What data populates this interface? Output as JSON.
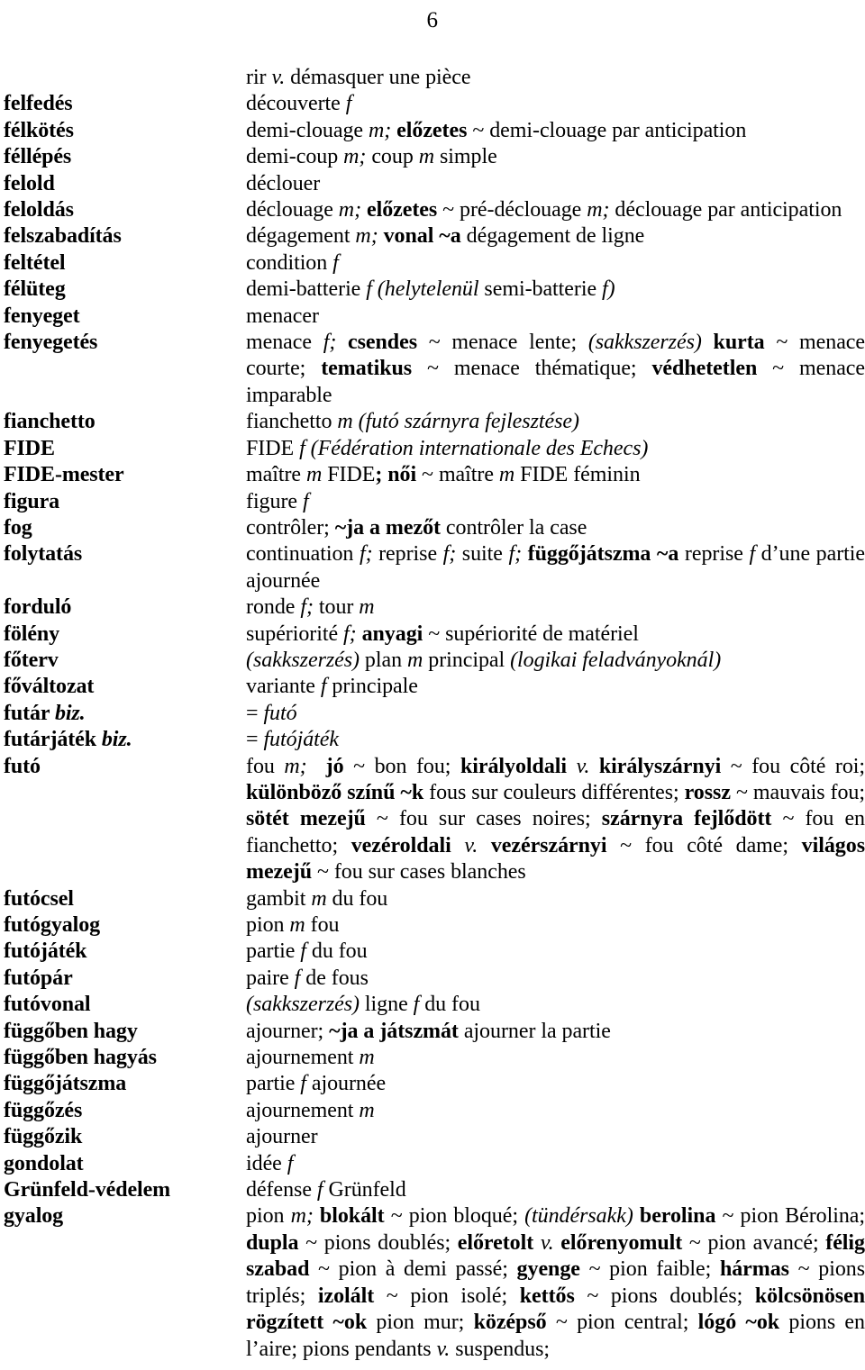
{
  "page": {
    "number": "6",
    "type": "dictionary-page",
    "source_language": "Hungarian",
    "target_language": "French",
    "subject": "chess"
  },
  "continuation_line": {
    "text_html": "rir <i>v.</i> démasquer une pièce"
  },
  "entries": [
    {
      "headword_html": "felfedés",
      "definition_html": "découverte <i>f</i>",
      "justify": false
    },
    {
      "headword_html": "félkötés",
      "definition_html": "demi-clouage <i>m;</i> <b>előzetes</b> ~ demi-clouage par anticipation",
      "justify": false
    },
    {
      "headword_html": "féllépés",
      "definition_html": "demi-coup <i>m;</i> coup <i>m</i> simple",
      "justify": false
    },
    {
      "headword_html": "felold",
      "definition_html": "déclouer",
      "justify": false
    },
    {
      "headword_html": "feloldás",
      "definition_html": "déclouage <i>m;</i> <b>előzetes</b> ~ pré-déclouage <i>m;</i> déclouage par anti&shy;cipation",
      "justify": true
    },
    {
      "headword_html": "felszabadítás",
      "definition_html": "dégagement <i>m;</i> <b>vonal ~a</b> dégagement de ligne",
      "justify": false
    },
    {
      "headword_html": "feltétel",
      "definition_html": "condition <i>f</i>",
      "justify": false
    },
    {
      "headword_html": "félüteg",
      "definition_html": "demi-batterie <i>f (helytelenül</i> semi-batterie <i>f)</i>",
      "justify": false
    },
    {
      "headword_html": "fenyeget",
      "definition_html": "menacer",
      "justify": false
    },
    {
      "headword_html": "fenyegetés",
      "definition_html": "menace <i>f;</i> <b>csendes</b> ~ menace lente; <i>(sakkszerzés)</i> <b>kurta</b> ~ menace courte; <b>tematikus</b> ~ menace thématique; <b>védhetetlen</b> ~ menace imparable",
      "justify": true
    },
    {
      "headword_html": "fianchetto",
      "definition_html": "fianchetto <i>m (futó szárnyra fejlesztése)</i>",
      "justify": false
    },
    {
      "headword_html": "FIDE",
      "definition_html": "FIDE <i>f (Fédération internationale des Echecs)</i>",
      "justify": false
    },
    {
      "headword_html": "FIDE-mester",
      "definition_html": "maître <i>m</i> FIDE<b>; női</b> ~ maître <i>m</i> FIDE féminin",
      "justify": false
    },
    {
      "headword_html": "figura",
      "definition_html": "figure <i>f</i>",
      "justify": false
    },
    {
      "headword_html": "fog",
      "definition_html": "contrôler; <b>~ja a mezőt</b> contrôler la case",
      "justify": false
    },
    {
      "headword_html": "folytatás",
      "definition_html": "continuation <i>f;</i> reprise <i>f;</i> suite <i>f;</i> <b>függőjátszma ~a</b> reprise <i>f</i> d&rsquo;une partie ajournée",
      "justify": true
    },
    {
      "headword_html": "forduló",
      "definition_html": "ronde <i>f;</i> tour <i>m</i>",
      "justify": false
    },
    {
      "headword_html": "fölény",
      "definition_html": "supériorité <i>f;</i> <b>anyagi</b> ~ supériorité de matériel",
      "justify": false
    },
    {
      "headword_html": "főterv",
      "definition_html": "<i>(sakkszerzés)</i> plan <i>m</i> principal <i>(logikai feladványoknál)</i>",
      "justify": false
    },
    {
      "headword_html": "főváltozat",
      "definition_html": "variante <i>f</i> principale",
      "justify": false
    },
    {
      "headword_html": "futár <span class=\"abbr\">biz.</span>",
      "definition_html": "= <i>futó</i>",
      "justify": false
    },
    {
      "headword_html": "futárjáték <span class=\"abbr\">biz.</span>",
      "definition_html": "= <i>futójáték</i>",
      "justify": false
    },
    {
      "headword_html": "futó",
      "definition_html": "fou <i>m;</i>&nbsp; <b>jó</b> ~ bon fou; <b>királyoldali</b> <i>v.</i> <b>királyszárnyi</b> ~ fou côté roi; <b>különböző színű ~k</b> fous sur couleurs différentes; <b>rossz</b> ~ mauvais fou; <b>sötét mezejű</b> ~ fou sur cases noires; <b>szárnyra fejlődött</b> ~ fou en fianchetto; <b>vezéroldali</b> <i>v.</i> <b>vezérszárnyi</b> ~ fou côté dame; <b>világos mezejű</b> ~ fou sur cases blanches",
      "justify": true
    },
    {
      "headword_html": "futócsel",
      "definition_html": "gambit <i>m</i> du fou",
      "justify": false
    },
    {
      "headword_html": "futógyalog",
      "definition_html": "pion <i>m</i> fou",
      "justify": false
    },
    {
      "headword_html": "futójáték",
      "definition_html": "partie <i>f</i> du fou",
      "justify": false
    },
    {
      "headword_html": "futópár",
      "definition_html": "paire <i>f</i> de fous",
      "justify": false
    },
    {
      "headword_html": "futóvonal",
      "definition_html": "<i>(sakkszerzés)</i> ligne <i>f</i> du fou",
      "justify": false
    },
    {
      "headword_html": "függőben hagy",
      "definition_html": "ajourner; <b>~ja a játszmát</b> ajourner la partie",
      "justify": false
    },
    {
      "headword_html": "függőben hagyás",
      "definition_html": "ajournement <i>m</i>",
      "justify": false
    },
    {
      "headword_html": "függőjátszma",
      "definition_html": "partie <i>f</i> ajournée",
      "justify": false
    },
    {
      "headword_html": "függőzés",
      "definition_html": "ajournement <i>m</i>",
      "justify": false
    },
    {
      "headword_html": "függőzik",
      "definition_html": "ajourner",
      "justify": false
    },
    {
      "headword_html": "gondolat",
      "definition_html": "idée <i>f</i>",
      "justify": false
    },
    {
      "headword_html": "Grünfeld-védelem",
      "definition_html": "défense <i>f</i> Grünfeld",
      "justify": false
    },
    {
      "headword_html": "gyalog",
      "definition_html": "pion <i>m;</i> <b>blokált</b> ~ pion bloqué; <i>(tündérsakk)</i> <b>berolina</b> ~ pion Bérolina; <b>dupla</b> ~ pions doublés; <b>előretolt</b> <i>v.</i> <b>előrenyomult</b> ~ pion avancé; <b>félig szabad</b> ~ pion à demi passé; <b>gyenge</b> ~ pion faible; <b>hármas</b> ~ pions triplés; <b>izolált</b> ~ pion isolé; <b>kettős</b> ~ pions doublés; <b>kölcsönösen rögzített ~ok</b> pion mur; <b>középső</b> ~ pion central; <b>lógó ~ok</b> pions en l&rsquo;aire; pions pendants <i>v.</i> suspendus;",
      "justify": true
    }
  ]
}
